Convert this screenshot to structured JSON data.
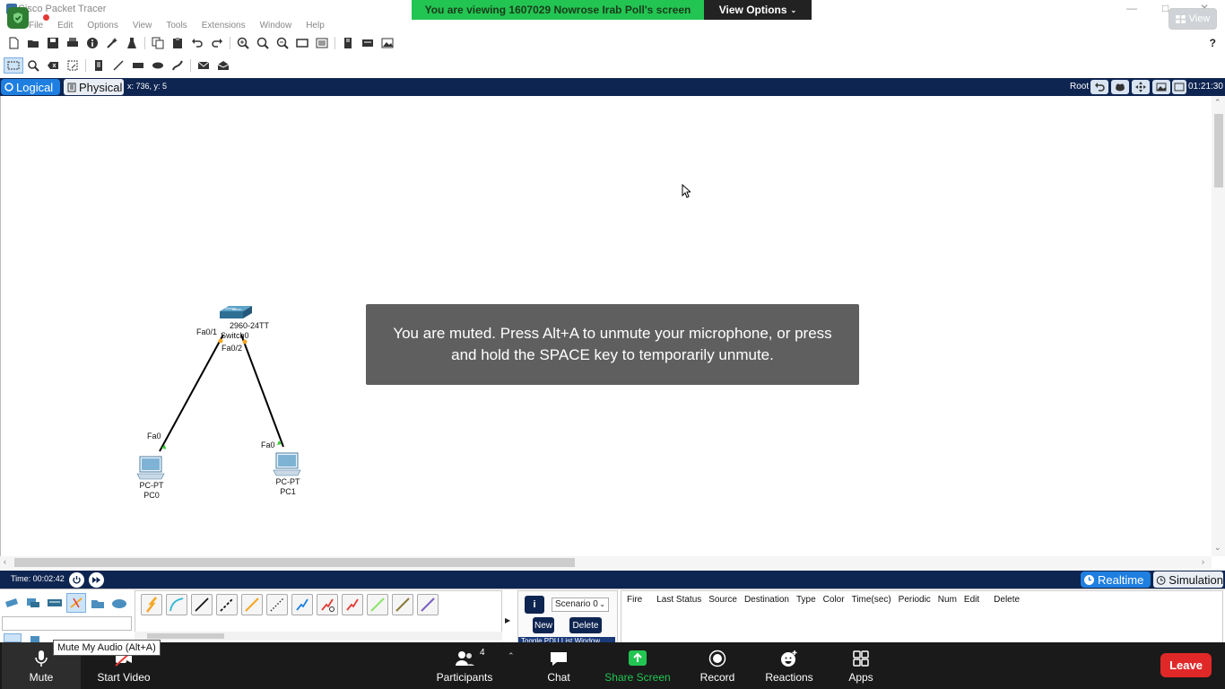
{
  "window": {
    "title": "Cisco Packet Tracer",
    "view_label": "View"
  },
  "share_banner": {
    "message": "You are viewing 1607029 Nowrose Irab Poll's screen",
    "view_options": "View Options"
  },
  "menu": [
    "File",
    "Edit",
    "Options",
    "View",
    "Tools",
    "Extensions",
    "Window",
    "Help"
  ],
  "toolbar": {
    "help": "?",
    "main_icons": [
      "new-icon",
      "open-icon",
      "save-icon",
      "print-icon",
      "info-icon",
      "wizard-icon",
      "activity-icon",
      "copy-icon",
      "paste-icon",
      "undo-icon",
      "redo-icon",
      "zoom-in-icon",
      "zoom-reset-icon",
      "zoom-out-icon",
      "drawing-palette-icon",
      "custom-device-icon",
      "cluster-icon",
      "device-template-icon",
      "image-icon"
    ],
    "edit_icons": [
      "select-icon",
      "inspect-icon",
      "delete-icon",
      "resize-icon",
      "note-icon",
      "line-icon",
      "rectangle-icon",
      "ellipse-icon",
      "freeform-icon",
      "simple-pdu-icon",
      "complex-pdu-icon"
    ]
  },
  "workspace_bar": {
    "logical_tab": "Logical",
    "physical_tab": "Physical",
    "coords": "x: 736, y: 5",
    "root_label": "Root",
    "clock": "01:21:30"
  },
  "topology": {
    "switch": {
      "model": "2960-24TT",
      "name": "Switch0",
      "port_left": "Fa0/1",
      "port_right": "Fa0/2"
    },
    "pc0": {
      "type": "PC-PT",
      "name": "PC0",
      "port": "Fa0"
    },
    "pc1": {
      "type": "PC-PT",
      "name": "PC1",
      "port": "Fa0"
    }
  },
  "muted_notice": "You are muted. Press Alt+A to unmute your microphone, or press and hold the SPACE key to temporarily unmute.",
  "timebar": {
    "time": "Time: 00:02:42",
    "realtime": "Realtime",
    "simulation": "Simulation"
  },
  "pdu": {
    "scenario": "Scenario 0",
    "new": "New",
    "delete": "Delete",
    "list_tab": "Toggle PDU List Window"
  },
  "event_columns": [
    "Fire",
    "Last Status",
    "Source",
    "Destination",
    "Type",
    "Color",
    "Time(sec)",
    "Periodic",
    "Num",
    "Edit",
    "Delete"
  ],
  "zoom": {
    "mute": "Mute",
    "start_video": "Start Video",
    "participants": "Participants",
    "participants_count": "4",
    "chat": "Chat",
    "share_screen": "Share Screen",
    "record": "Record",
    "reactions": "Reactions",
    "apps": "Apps",
    "leave": "Leave",
    "tooltip": "Mute My Audio (Alt+A)"
  },
  "colors": {
    "bar_navy": "#0f2551",
    "accent_blue": "#1e7fe0",
    "banner_green": "#23c552",
    "share_green": "#23c552",
    "leave_red": "#e02828",
    "muted_gray": "#5f5f5f"
  }
}
